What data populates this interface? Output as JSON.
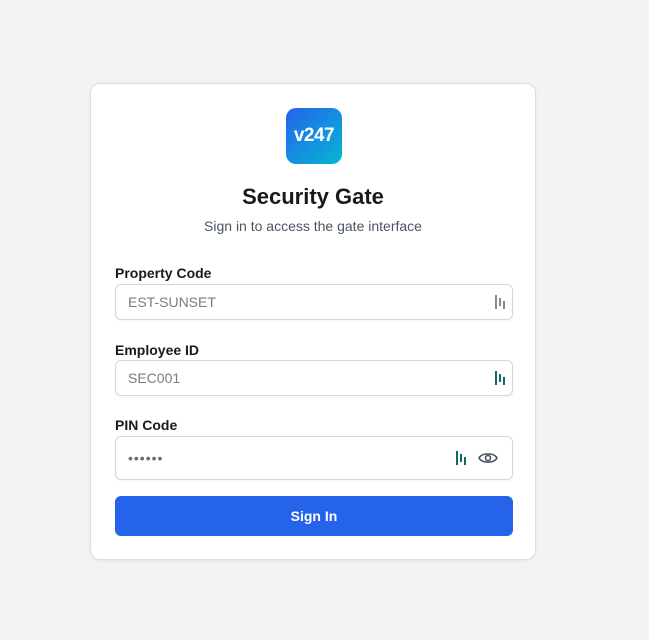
{
  "logo": {
    "text": "v247"
  },
  "header": {
    "title": "Security Gate",
    "subtitle": "Sign in to access the gate interface"
  },
  "form": {
    "property_code": {
      "label": "Property Code",
      "placeholder": "EST-SUNSET",
      "value": ""
    },
    "employee_id": {
      "label": "Employee ID",
      "placeholder": "SEC001",
      "value": ""
    },
    "pin_code": {
      "label": "PIN Code",
      "masked_value": "••••••"
    },
    "submit_label": "Sign In"
  },
  "icons": {
    "autofill": "password-manager-icon",
    "reveal": "eye-icon"
  },
  "colors": {
    "accent": "#2563eb",
    "logo_gradient_start": "#2563eb",
    "logo_gradient_end": "#06b6d4",
    "autofill_icon_active": "#0f6b6b",
    "autofill_icon_inactive": "#8a8a8a"
  }
}
